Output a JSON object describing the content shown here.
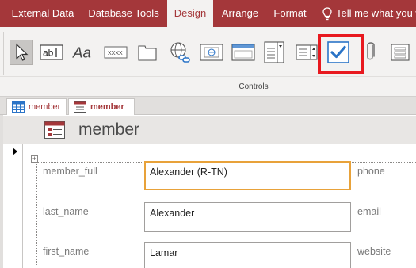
{
  "ribbon_tabs": [
    {
      "label": "External Data",
      "active": false
    },
    {
      "label": "Database Tools",
      "active": false
    },
    {
      "label": "Design",
      "active": true
    },
    {
      "label": "Arrange",
      "active": false
    },
    {
      "label": "Format",
      "active": false
    }
  ],
  "tell_me": {
    "text": "Tell me what you w",
    "icon": "lightbulb-icon"
  },
  "controls_group": {
    "label": "Controls",
    "items": [
      {
        "name": "select-pointer",
        "icon": "pointer-icon",
        "selected": true
      },
      {
        "name": "text-box",
        "icon": "text-box-icon",
        "glyph": "ab|"
      },
      {
        "name": "label",
        "icon": "label-icon",
        "glyph": "Aa"
      },
      {
        "name": "button",
        "icon": "button-icon",
        "glyph": "XXXX"
      },
      {
        "name": "tab-control",
        "icon": "tab-control-icon"
      },
      {
        "name": "hyperlink",
        "icon": "hyperlink-icon"
      },
      {
        "name": "web-browser",
        "icon": "web-browser-icon"
      },
      {
        "name": "navigation-control",
        "icon": "navigation-icon"
      },
      {
        "name": "combo-box",
        "icon": "combo-box-icon"
      },
      {
        "name": "list-box",
        "icon": "list-box-icon"
      },
      {
        "name": "check-box",
        "icon": "checkbox-icon",
        "highlighted": true
      },
      {
        "name": "attachment",
        "icon": "attachment-icon"
      },
      {
        "name": "option-group",
        "icon": "option-group-icon"
      }
    ]
  },
  "document_tabs": [
    {
      "label": "member",
      "icon": "table-icon",
      "active": false
    },
    {
      "label": "member",
      "icon": "form-icon",
      "active": true
    }
  ],
  "form": {
    "title": "member",
    "fields": [
      {
        "label": "member_full",
        "value": "Alexander (R-TN)",
        "right_label": "phone",
        "focused": true
      },
      {
        "label": "last_name",
        "value": "Alexander",
        "right_label": "email",
        "focused": false
      },
      {
        "label": "first_name",
        "value": "Lamar",
        "right_label": "website",
        "focused": false
      }
    ]
  },
  "colors": {
    "accent": "#a4373a",
    "highlight_box": "#e8191f",
    "focus_border": "#e8a23a",
    "checkbox_blue": "#2b74c7"
  }
}
